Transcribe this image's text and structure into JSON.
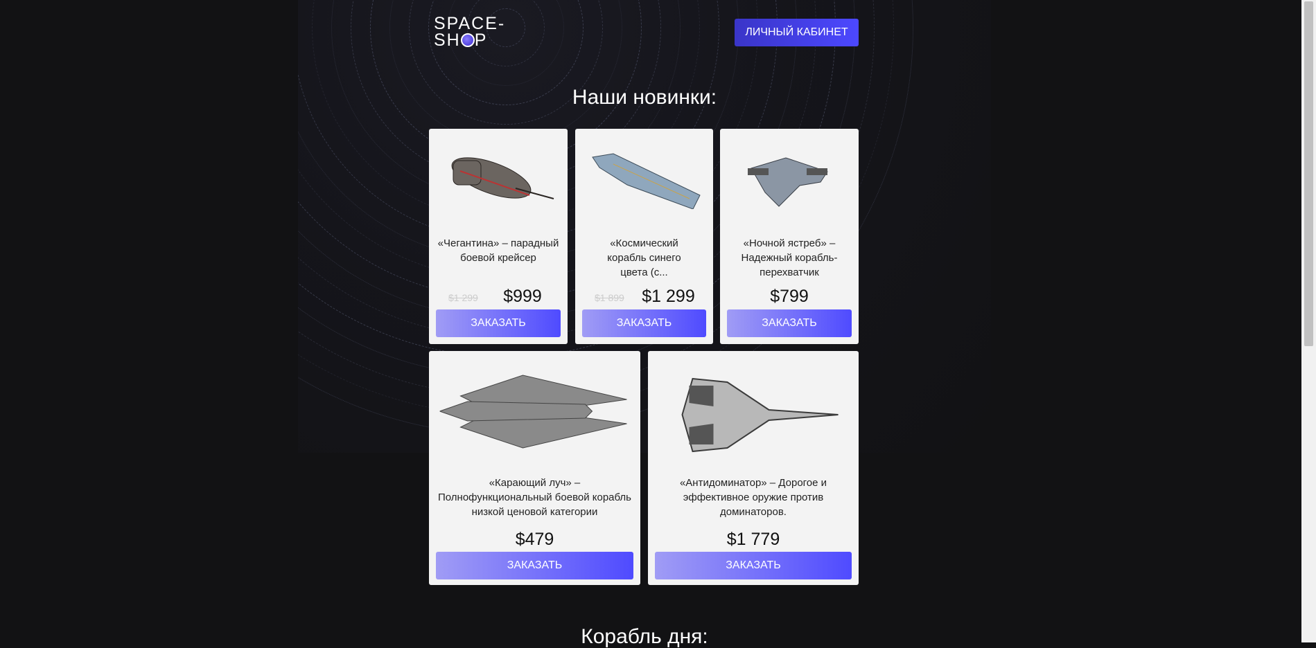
{
  "header": {
    "logo_line1": "SPACE-",
    "logo_line2_a": "SH",
    "logo_line2_b": "P",
    "cabinet_label": "ЛИЧНЫЙ КАБИНЕТ"
  },
  "new_section": {
    "title": "Наши новинки:"
  },
  "products": [
    {
      "desc": "«Чегантина» – парадный боевой крейсер",
      "old_price": "$1 299",
      "price": "$999",
      "button": "ЗАКАЗАТЬ"
    },
    {
      "desc": "«Космический корабль синего цвета (с...",
      "old_price": "$1 899",
      "price": "$1 299",
      "button": "ЗАКАЗАТЬ"
    },
    {
      "desc": "«Ночной ястреб» – Надежный корабль-перехватчик",
      "price": "$799",
      "button": "ЗАКАЗАТЬ"
    },
    {
      "desc": "«Карающий луч» – Полнофункциональный боевой корабль низкой ценовой категории",
      "price": "$479",
      "button": "ЗАКАЗАТЬ"
    },
    {
      "desc": "«Антидоминатор» – Дорогое и эффективное оружие против доминаторов.",
      "price": "$1 779",
      "button": "ЗАКАЗАТЬ"
    }
  ],
  "ship_of_day": {
    "title": "Корабль дня:"
  }
}
